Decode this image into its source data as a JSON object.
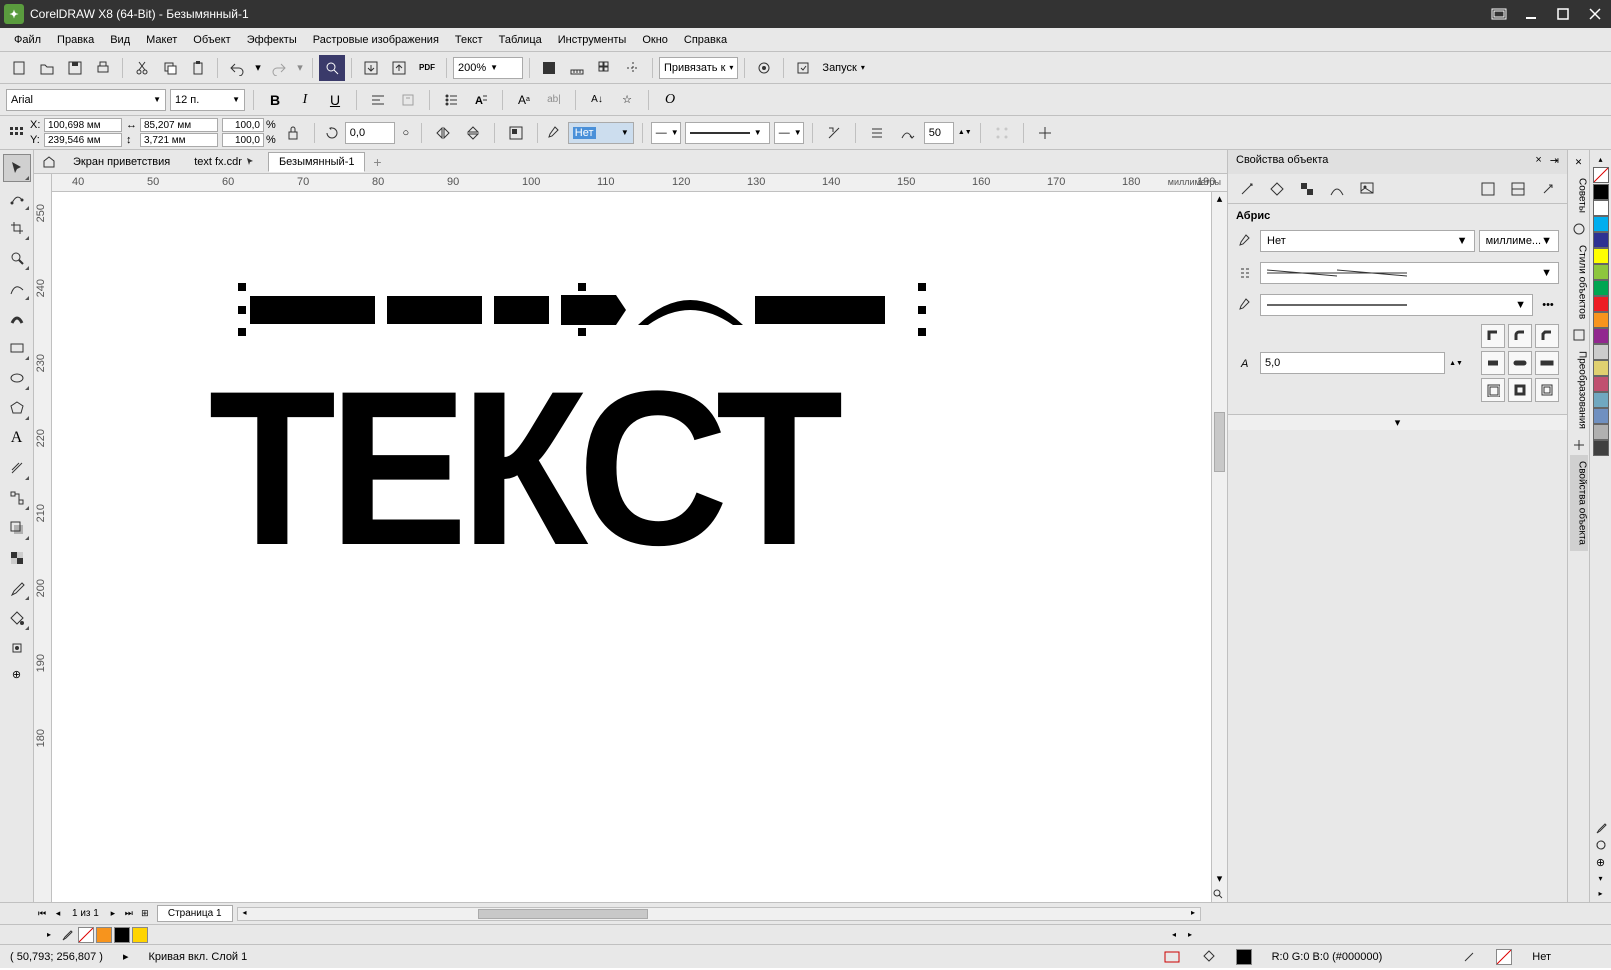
{
  "app": {
    "title": "CorelDRAW X8 (64-Bit) - Безымянный-1"
  },
  "menu": [
    "Файл",
    "Правка",
    "Вид",
    "Макет",
    "Объект",
    "Эффекты",
    "Растровые изображения",
    "Текст",
    "Таблица",
    "Инструменты",
    "Окно",
    "Справка"
  ],
  "toolbar": {
    "zoom": "200%",
    "snap_label": "Привязать к",
    "launch_label": "Запуск"
  },
  "propbar": {
    "font": "Arial",
    "size": "12 п."
  },
  "propbar2": {
    "x": "100,698 мм",
    "y": "239,546 мм",
    "w": "85,207 мм",
    "h": "3,721 мм",
    "sx": "100,0",
    "sy": "100,0",
    "pct": "%",
    "angle": "0,0",
    "outline_value": "Нет",
    "num": "50"
  },
  "tabs": {
    "welcome": "Экран приветствия",
    "doc1": "text fx.cdr",
    "doc2": "Безымянный-1"
  },
  "ruler": {
    "unit": "миллиметры",
    "h_ticks": [
      "40",
      "50",
      "60",
      "70",
      "80",
      "90",
      "100",
      "110",
      "120",
      "130",
      "140",
      "150",
      "160",
      "170",
      "180",
      "190"
    ],
    "v_ticks": [
      "250",
      "240",
      "230",
      "220",
      "210",
      "200",
      "190",
      "180"
    ]
  },
  "canvas": {
    "text": "ТЕКСТ"
  },
  "pagenav": {
    "label": "1 из 1",
    "page_tab": "Страница 1"
  },
  "status": {
    "coord": "( 50,793; 256,807 )",
    "layer": "Кривая вкл. Слой 1",
    "color": "R:0 G:0 B:0 (#000000)",
    "outline": "Нет"
  },
  "docker": {
    "title": "Свойства объекта",
    "section": "Абрис",
    "outline": "Нет",
    "unit": "миллиме...",
    "width": "5,0"
  },
  "side_tabs": [
    "Советы",
    "Стили объектов",
    "Преобразования",
    "Свойства объекта"
  ],
  "palette": [
    "#000000",
    "#ffffff",
    "#00aeef",
    "#2e3192",
    "#ffff00",
    "#8dc63e",
    "#00a651",
    "#ed1c24",
    "#f7941d",
    "#92278f",
    "#cccccc",
    "#e0d070",
    "#c05070",
    "#70a8c0",
    "#7090c0",
    "#b0b0b0",
    "#404040"
  ]
}
